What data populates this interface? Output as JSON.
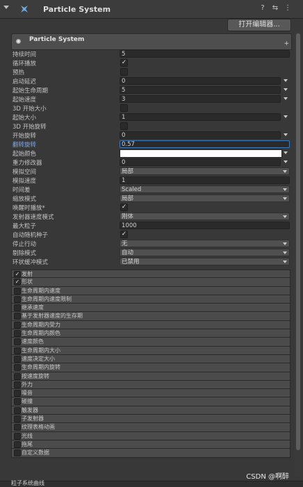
{
  "header": {
    "title": "Particle System",
    "help_icon": "?",
    "settings_icon": "⇆",
    "menu_icon": "⋮"
  },
  "open_editor_label": "打开编辑器...",
  "main_module": {
    "name": "Particle System",
    "plus": "+"
  },
  "properties": [
    {
      "label": "持续时间",
      "type": "field",
      "value": "5"
    },
    {
      "label": "循环播放",
      "type": "checkbox",
      "checked": true
    },
    {
      "label": "预热",
      "type": "checkbox",
      "checked": false
    },
    {
      "label": "启动延迟",
      "type": "curve",
      "value": "0"
    },
    {
      "label": "起始生命周期",
      "type": "curve",
      "value": "5"
    },
    {
      "label": "起始速度",
      "type": "curve",
      "value": "3"
    },
    {
      "label": "3D 开始大小",
      "type": "checkbox",
      "checked": false
    },
    {
      "label": "起始大小",
      "type": "curve",
      "value": "1"
    },
    {
      "label": "3D 开始旋转",
      "type": "checkbox",
      "checked": false
    },
    {
      "label": "开始旋转",
      "type": "curve",
      "value": "0"
    },
    {
      "label": "翻转旋转",
      "type": "field",
      "value": "0.57",
      "focused": true
    },
    {
      "label": "起始颜色",
      "type": "color",
      "value": "#ffffff"
    },
    {
      "label": "重力修改器",
      "type": "curve",
      "value": "0"
    },
    {
      "label": "模拟空间",
      "type": "popup",
      "value": "局部"
    },
    {
      "label": "模拟速度",
      "type": "field",
      "value": "1"
    },
    {
      "label": "时间差",
      "type": "popup",
      "value": "Scaled"
    },
    {
      "label": "缩放模式",
      "type": "popup",
      "value": "局部"
    },
    {
      "label": "唤醒时播放*",
      "type": "checkbox",
      "checked": true
    },
    {
      "label": "发射器速度模式",
      "type": "popup",
      "value": "刚体"
    },
    {
      "label": "最大粒子",
      "type": "field",
      "value": "1000"
    },
    {
      "label": "自动随机种子",
      "type": "checkbox",
      "checked": true
    },
    {
      "label": "停止行动",
      "type": "popup",
      "value": "无"
    },
    {
      "label": "剔除模式",
      "type": "popup",
      "value": "自动"
    },
    {
      "label": "环状缓冲模式",
      "type": "popup",
      "value": "已禁用"
    }
  ],
  "modules": [
    {
      "name": "发射",
      "enabled": true
    },
    {
      "name": "形状",
      "enabled": true
    },
    {
      "name": "生命周期内速度",
      "enabled": false
    },
    {
      "name": "生命周期内速度限制",
      "enabled": false
    },
    {
      "name": "继承速度",
      "enabled": false
    },
    {
      "name": "基于发射器速度的生存期",
      "enabled": false
    },
    {
      "name": "生命周期内受力",
      "enabled": false
    },
    {
      "name": "生命周期内颜色",
      "enabled": false
    },
    {
      "name": "速度颜色",
      "enabled": false
    },
    {
      "name": "生命周期内大小",
      "enabled": false
    },
    {
      "name": "速度决定大小",
      "enabled": false
    },
    {
      "name": "生命周期内旋转",
      "enabled": false
    },
    {
      "name": "按速度旋转",
      "enabled": false
    },
    {
      "name": "外力",
      "enabled": false
    },
    {
      "name": "噪音",
      "enabled": false
    },
    {
      "name": "碰撞",
      "enabled": false
    },
    {
      "name": "触发器",
      "enabled": false
    },
    {
      "name": "子发射器",
      "enabled": false
    },
    {
      "name": "纹理表格动画",
      "enabled": false
    },
    {
      "name": "光线",
      "enabled": false
    },
    {
      "name": "拖尾",
      "enabled": false
    },
    {
      "name": "自定义数据",
      "enabled": false
    }
  ],
  "bottom_label": "粒子系统曲线",
  "watermark": "CSDN @啊醉"
}
